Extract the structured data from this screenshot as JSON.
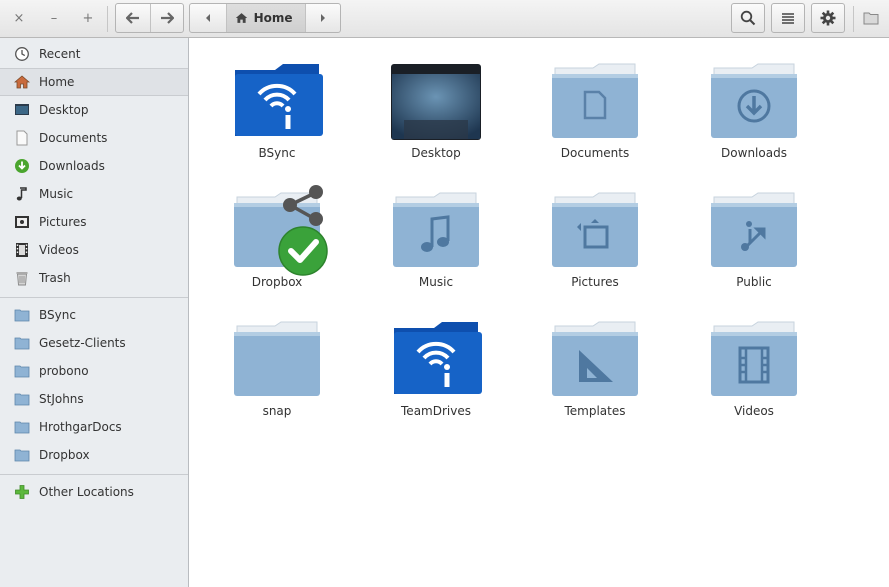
{
  "window": {
    "title": "Home"
  },
  "titlebar_buttons": {
    "close": "×",
    "minimize": "–",
    "maximize": "+"
  },
  "breadcrumb": {
    "current": "Home"
  },
  "sidebar": {
    "places": [
      {
        "label": "Recent",
        "icon": "recent-icon"
      },
      {
        "label": "Home",
        "icon": "home-icon",
        "selected": true
      },
      {
        "label": "Desktop",
        "icon": "desktop-icon"
      },
      {
        "label": "Documents",
        "icon": "documents-icon"
      },
      {
        "label": "Downloads",
        "icon": "downloads-icon"
      },
      {
        "label": "Music",
        "icon": "music-icon"
      },
      {
        "label": "Pictures",
        "icon": "pictures-icon"
      },
      {
        "label": "Videos",
        "icon": "videos-icon"
      },
      {
        "label": "Trash",
        "icon": "trash-icon"
      }
    ],
    "bookmarks": [
      {
        "label": "BSync",
        "icon": "folder-icon"
      },
      {
        "label": "Gesetz-Clients",
        "icon": "folder-icon"
      },
      {
        "label": "probono",
        "icon": "folder-icon"
      },
      {
        "label": "StJohns",
        "icon": "folder-icon"
      },
      {
        "label": "HrothgarDocs",
        "icon": "folder-icon"
      },
      {
        "label": "Dropbox",
        "icon": "folder-icon"
      }
    ],
    "other": {
      "label": "Other Locations",
      "icon": "plus-icon"
    }
  },
  "files": [
    {
      "name": "BSync",
      "type": "teamdrive"
    },
    {
      "name": "Desktop",
      "type": "desktop"
    },
    {
      "name": "Documents",
      "type": "documents"
    },
    {
      "name": "Downloads",
      "type": "downloads"
    },
    {
      "name": "Dropbox",
      "type": "dropbox"
    },
    {
      "name": "Music",
      "type": "music"
    },
    {
      "name": "Pictures",
      "type": "pictures"
    },
    {
      "name": "Public",
      "type": "public"
    },
    {
      "name": "snap",
      "type": "plain"
    },
    {
      "name": "TeamDrives",
      "type": "teamdrive"
    },
    {
      "name": "Templates",
      "type": "templates"
    },
    {
      "name": "Videos",
      "type": "videos"
    }
  ],
  "colors": {
    "folder_top": "#c2d6e6",
    "folder_body": "#8fb3d4",
    "teamdrive": "#1663c7",
    "dropbox_check": "#3aa23a"
  }
}
